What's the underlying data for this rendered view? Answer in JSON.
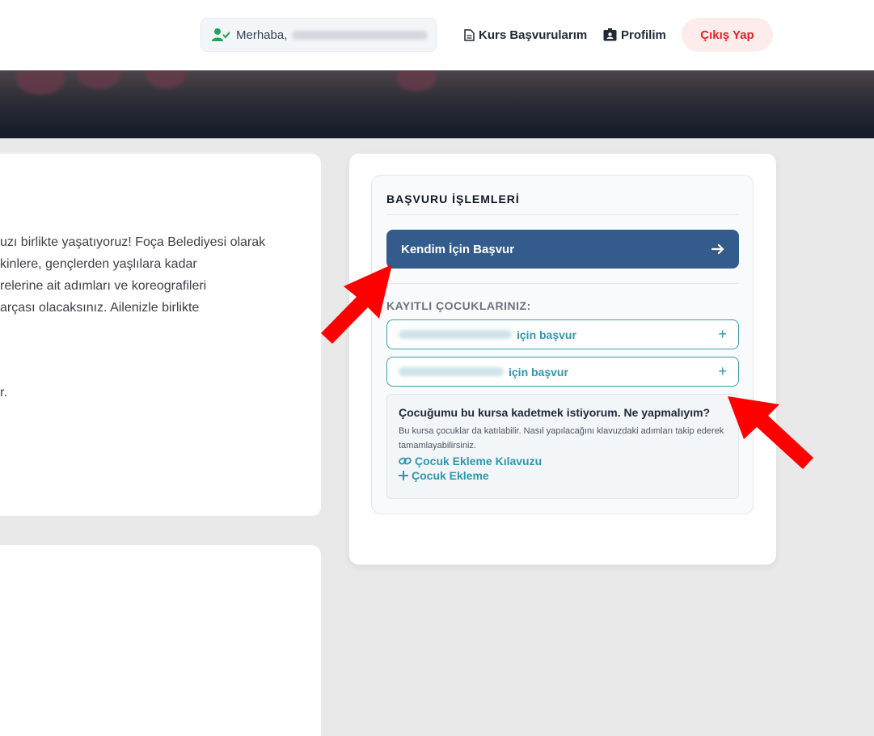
{
  "header": {
    "greeting_prefix": "Merhaba,",
    "nav_applications": "Kurs Başvurularım",
    "nav_profile": "Profilim",
    "logout_label": "Çıkış Yap"
  },
  "description": {
    "lines": [
      "uzı birlikte yaşatıyoruz! Foça Belediyesi olarak",
      "kinlere, gençlerden yaşlılara kadar",
      "relerine ait adımları ve koreografileri",
      "arçası olacaksınız. Ailenizle birlikte"
    ],
    "line2": "r."
  },
  "application": {
    "title": "BAŞVURU İŞLEMLERİ",
    "apply_self_label": "Kendim İçin Başvur",
    "kids_label": "KAYITLI ÇOCUKLARINIZ:",
    "kid_apply_suffix": "için başvur",
    "help_title": "Çocuğumu bu kursa kadetmek istiyorum. Ne yapmalıyım?",
    "help_desc": "Bu kursa çocuklar da katılabilir. Nasıl yapılacağını klavuzdaki adımları takip ederek tamamlayabilirsiniz.",
    "guide_link": "Çocuk Ekleme Kılavuzu",
    "add_child_link": "Çocuk Ekleme"
  },
  "colors": {
    "primary": "#335b8c",
    "accent": "#2f96ad",
    "danger": "#dc2626",
    "annotation": "#ff0000"
  }
}
